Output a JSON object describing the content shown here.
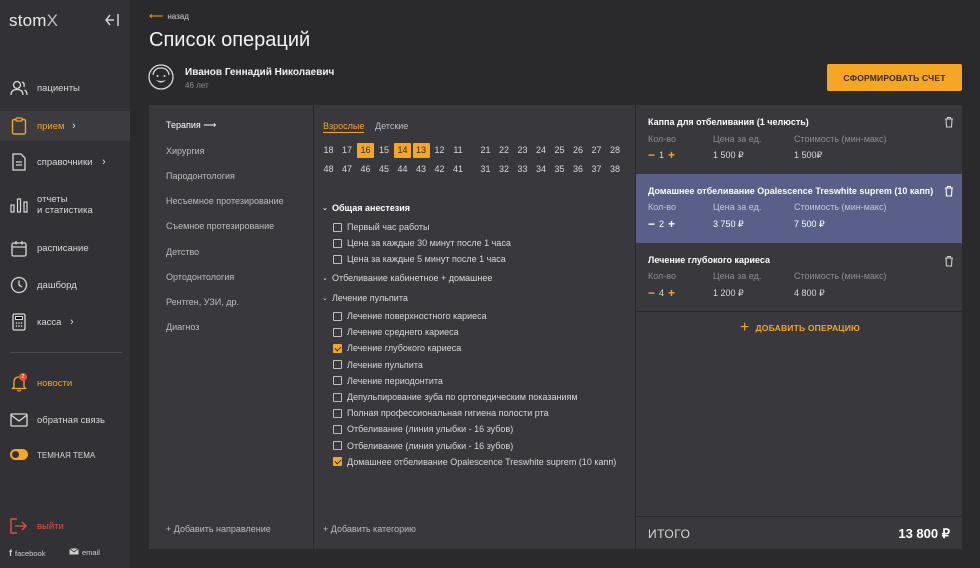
{
  "app": {
    "logo": "stom",
    "logo_x": "X"
  },
  "sidebar": {
    "items": [
      {
        "label": "пациенты",
        "icon": "users-icon"
      },
      {
        "label": "прием",
        "icon": "clipboard-icon"
      },
      {
        "label": "справочники",
        "icon": "document-icon"
      },
      {
        "label": "отчеты\nи статистика",
        "line1": "отчеты",
        "line2": "и статистика",
        "icon": "bar-chart-icon"
      },
      {
        "label": "расписание",
        "icon": "calendar-icon"
      },
      {
        "label": "дашборд",
        "icon": "clock-icon"
      },
      {
        "label": "касса",
        "icon": "calculator-icon"
      },
      {
        "label": "новости",
        "icon": "bell-icon",
        "badge": "2"
      },
      {
        "label": "обратная связь",
        "icon": "mail-icon"
      },
      {
        "label": "ТЕМНАЯ ТЕМА",
        "icon": "toggle"
      },
      {
        "label": "выйти",
        "icon": "logout-icon"
      }
    ],
    "footer": {
      "facebook": "facebook",
      "email": "email"
    }
  },
  "header": {
    "back": "назад",
    "title": "Список операций",
    "patient_name": "Иванов Геннадий Николаевич",
    "patient_age": "46 лет",
    "invoice_button": "СФОРМИРОВАТЬ СЧЕТ"
  },
  "directions": {
    "items": [
      "Терапия",
      "Хирургия",
      "Пародонтология",
      "Несъемное протезирование",
      "Съемное протезирование",
      "Детство",
      "Ортодонтология",
      "Рентген, УЗИ, др.",
      "Диагноз"
    ],
    "active_arrow": "⟶",
    "add": "Добавить направление"
  },
  "age_tabs": [
    "Взрослые",
    "Детские"
  ],
  "teeth": {
    "upper_left": [
      "18",
      "17",
      "16",
      "15",
      "14",
      "13",
      "12",
      "11"
    ],
    "upper_right": [
      "21",
      "22",
      "23",
      "24",
      "25",
      "26",
      "27",
      "28"
    ],
    "lower_left": [
      "48",
      "47",
      "46",
      "45",
      "44",
      "43",
      "42",
      "41"
    ],
    "lower_right": [
      "31",
      "32",
      "33",
      "34",
      "35",
      "36",
      "37",
      "38"
    ],
    "selected": [
      "16",
      "14",
      "13"
    ]
  },
  "tree": {
    "anesthesia": "Общая анестезия",
    "anesthesia_items": [
      "Первый час работы",
      "Цена за каждые 30 минут после 1 часа",
      "Цена за каждые 5 минут после 1 часа"
    ],
    "whitening": "Отбеливание кабинетное + домашнее",
    "pulpitis": "Лечение пульпита",
    "pulpitis_items": [
      "Лечение поверхностного кариеса",
      "Лечение среднего кариеса",
      "Лечение глубокого кариеса",
      "Лечение пульпита",
      "Лечение периодонтита",
      "Депульпирование зуба по ортопедическим показаниям",
      "Полная профессиональная гигиена полости рта",
      "Отбеливание (линия улыбки - 16 зубов)",
      "Отбеливание (линия улыбки - 16 зубов)",
      "Домашнее отбеливание Opalescence Treswhite suprem (10 капп)"
    ],
    "pulpitis_checked": [
      false,
      false,
      true,
      false,
      false,
      false,
      false,
      false,
      false,
      true
    ],
    "add": "Добавить категорию"
  },
  "operations": {
    "labels": {
      "qty": "Кол-во",
      "price": "Цена за ед.",
      "cost": "Стоимость (мин-макс)"
    },
    "items": [
      {
        "title": "Каппа для отбеливания (1 челюсть)",
        "qty": "1",
        "price": "1 500 ₽",
        "cost": "1 500₽"
      },
      {
        "title": "Домашнее отбеливание Opalescence Treswhite suprem (10 капп)",
        "qty": "2",
        "price": "3 750 ₽",
        "cost": "7 500 ₽"
      },
      {
        "title": "Лечение глубокого кариеса",
        "qty": "4",
        "price": "1 200 ₽",
        "cost": "4 800 ₽"
      }
    ],
    "add": "ДОБАВИТЬ ОПЕРАЦИЮ",
    "total_label": "ИТОГО",
    "total_value": "13 800 ₽"
  },
  "colors": {
    "accent": "#f5a623",
    "highlight": "#5a5f8a",
    "danger": "#e84c3d"
  }
}
